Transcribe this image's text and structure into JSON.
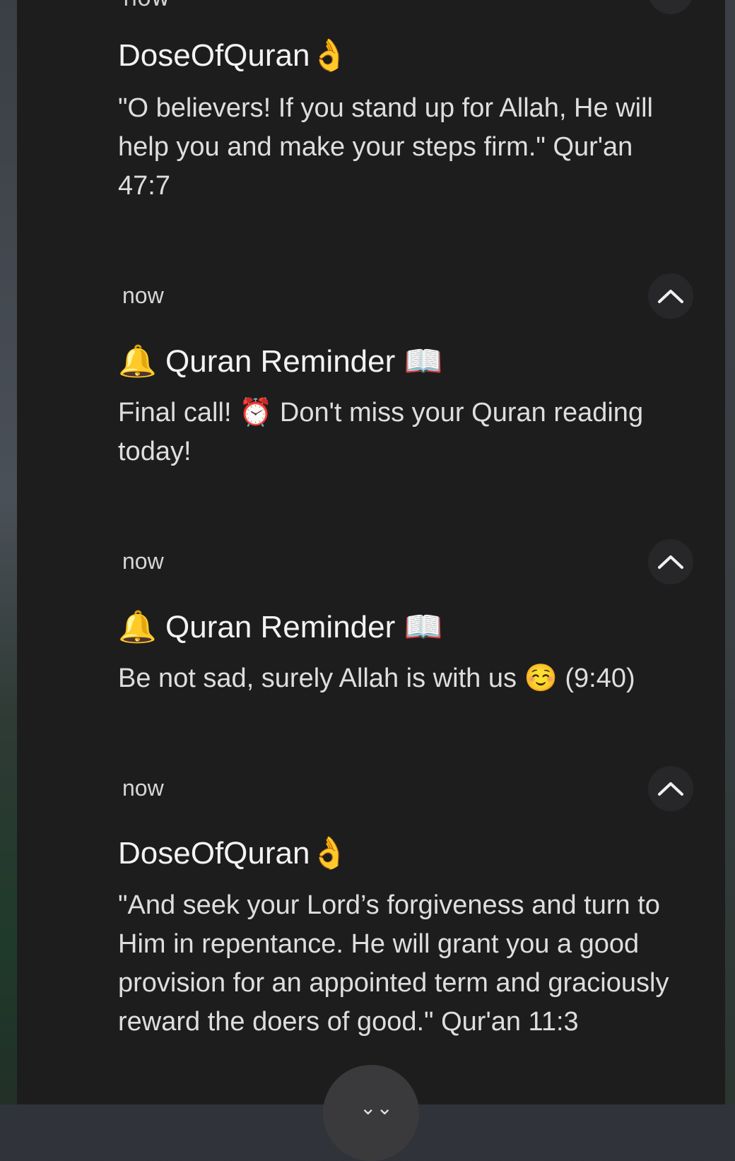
{
  "top_peek": {
    "time": "now"
  },
  "notifications": [
    {
      "time": "",
      "title": "DoseOfQuran👌",
      "body": "\"O believers! If you stand up for Allah, He will help you and make your steps firm.\" Qur'an 47:7"
    },
    {
      "time": "now",
      "title": "🔔 Quran Reminder 📖",
      "body": "Final call! ⏰ Don't miss your Quran reading today!"
    },
    {
      "time": "now",
      "title": "🔔 Quran Reminder 📖",
      "body": "Be not sad, surely Allah is with us ☺️ (9:40)"
    },
    {
      "time": "now",
      "title": "DoseOfQuran👌",
      "body": "\"And seek your Lord’s forgiveness and turn to Him in repentance. He will grant you a good provision for an appointed term and graciously reward the doers of good.\" Qur'an 11:3"
    }
  ],
  "icons": {
    "expand": "chevron-up-icon",
    "collapse_all": "chevron-down-icon"
  }
}
